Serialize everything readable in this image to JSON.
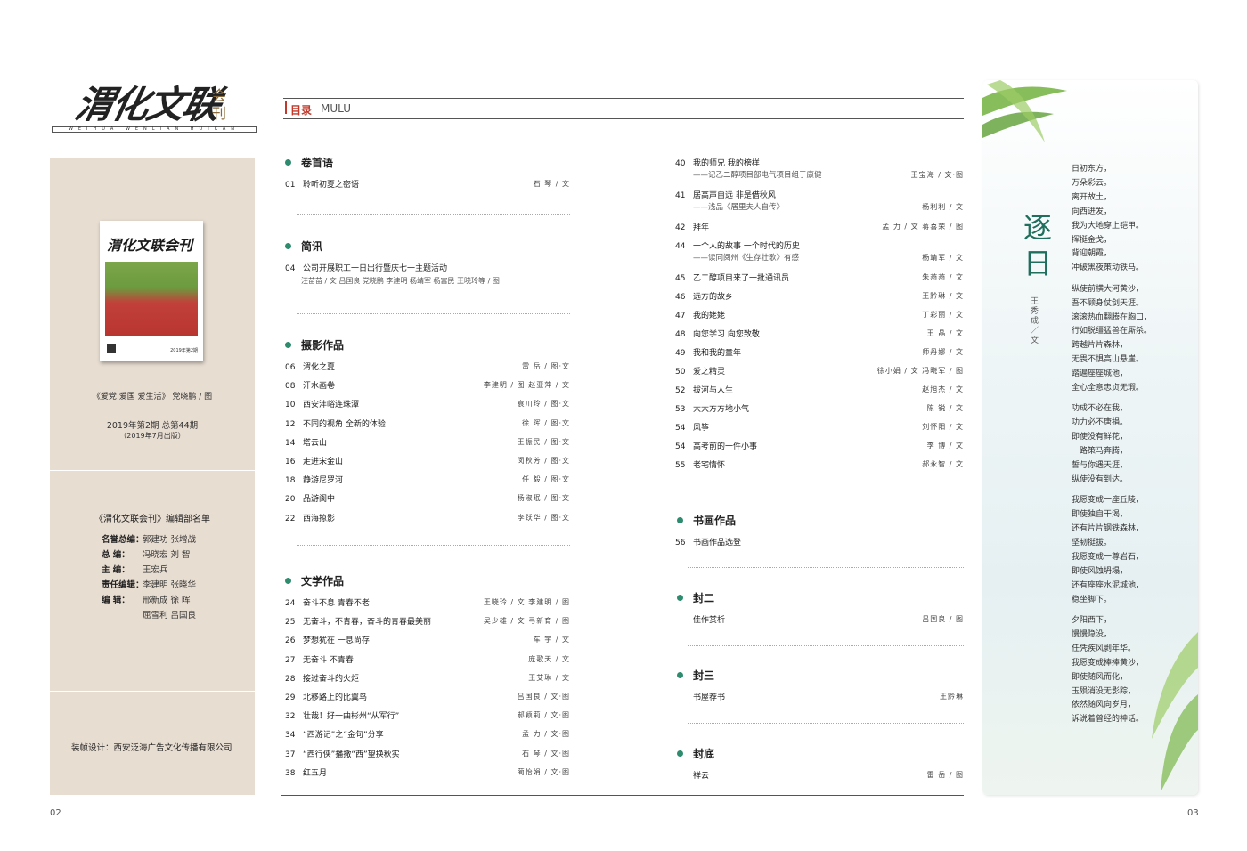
{
  "logo": {
    "main": "渭化文联",
    "sub": "会刊",
    "latin": "WEIHUA WENLIAN HUIKAN"
  },
  "sidebar": {
    "cover_title": "渭化文联会刊",
    "cover_issue": "2019年第2期",
    "cover_caption": "《爱党 爱国 爱生活》 党晓鹏 / 图",
    "issue": "2019年第2期 总第44期",
    "issue_date": "（2019年7月出版）",
    "editorial_title": "《渭化文联会刊》编辑部名单",
    "editors": [
      {
        "role": "名誉总编：",
        "names": "郭建功  张增战"
      },
      {
        "role": "总    编：",
        "names": "冯晓宏  刘  智"
      },
      {
        "role": "主    编：",
        "names": "王宏兵"
      },
      {
        "role": "责任编辑：",
        "names": "李建明  张晓华"
      },
      {
        "role": "编    辑：",
        "names": "邢新成  徐  晖"
      },
      {
        "role": "",
        "names": "屈雪利  吕国良"
      }
    ],
    "design": "装帧设计：西安泛海广告文化传播有限公司"
  },
  "page_numbers": {
    "left": "02",
    "right": "03"
  },
  "toc_header": {
    "label": "目录",
    "latin": "MULU"
  },
  "toc_left": [
    {
      "section": "卷首语",
      "entries": [
        {
          "num": "01",
          "title": "聆听初夏之密语",
          "credit": "石  琴 / 文"
        }
      ]
    },
    {
      "section": "简讯",
      "entries": [
        {
          "num": "04",
          "title": "公司开展职工一日出行暨庆七一主题活动",
          "credit": ""
        }
      ],
      "subcredit": "汪苗苗 / 文  吕国良  党晓鹏  李建明  杨靖军  杨富民  王晓玲等 / 图"
    },
    {
      "section": "摄影作品",
      "entries": [
        {
          "num": "06",
          "title": "渭化之夏",
          "credit": "雷  岳 / 图·文"
        },
        {
          "num": "08",
          "title": "汗水画卷",
          "credit": "李建明 / 图  赵亚萍 / 文"
        },
        {
          "num": "10",
          "title": "西安沣峪连珠潭",
          "credit": "袁川玲 / 图·文"
        },
        {
          "num": "12",
          "title": "不同的视角  全新的体验",
          "credit": "徐  晖 / 图·文"
        },
        {
          "num": "14",
          "title": "塔云山",
          "credit": "王振民 / 图·文"
        },
        {
          "num": "16",
          "title": "走进宋金山",
          "credit": "闵秋芳 / 图·文"
        },
        {
          "num": "18",
          "title": "静游尼罗河",
          "credit": "任  毅 / 图·文"
        },
        {
          "num": "20",
          "title": "品游阆中",
          "credit": "杨淑珉 / 图·文"
        },
        {
          "num": "22",
          "title": "西海掠影",
          "credit": "李跃华 / 图·文"
        }
      ]
    },
    {
      "section": "文学作品",
      "entries": [
        {
          "num": "24",
          "title": "奋斗不息  青春不老",
          "credit": "王晓玲 / 文  李建明 / 图"
        },
        {
          "num": "25",
          "title": "无奋斗，不青春，奋斗的青春最美丽",
          "credit": "吴少雄 / 文  弓新育 / 图"
        },
        {
          "num": "26",
          "title": "梦想犹在  一息尚存",
          "credit": "车  宇 / 文"
        },
        {
          "num": "27",
          "title": "无奋斗  不青春",
          "credit": "庞歌天 / 文"
        },
        {
          "num": "28",
          "title": "接过奋斗的火炬",
          "credit": "王艾琳 / 文"
        },
        {
          "num": "29",
          "title": "北移路上的比翼鸟",
          "credit": "吕国良 / 文·图"
        },
        {
          "num": "32",
          "title": "壮哉！好一曲彬州“从军行”",
          "credit": "郝颖莉 / 文·图"
        },
        {
          "num": "34",
          "title": "“西游记”之“金句”分享",
          "credit": "孟  力 / 文·图"
        },
        {
          "num": "37",
          "title": "“西行侠”播撒“西”望换秋实",
          "credit": "石  琴 / 文·图"
        },
        {
          "num": "38",
          "title": "红五月",
          "credit": "蔺怡娟 / 文·图"
        }
      ]
    }
  ],
  "toc_right": {
    "entries": [
      {
        "num": "40",
        "title": "我的师兄  我的榜样",
        "sub": "——记乙二醇项目部电气项目组于康健",
        "credit": "王宝海 / 文·图"
      },
      {
        "num": "41",
        "title": "居高声自远  非是借秋风",
        "sub": "——浅品《居里夫人自传》",
        "credit": "杨利利 / 文"
      },
      {
        "num": "42",
        "title": "拜年",
        "sub": "",
        "credit": "孟  力 / 文  蒋喜荣 / 图"
      },
      {
        "num": "44",
        "title": "一个人的故事  一个时代的历史",
        "sub": "——读同阅州《生存壮歌》有感",
        "credit": "杨靖军 / 文"
      },
      {
        "num": "45",
        "title": "乙二醇项目来了一批通讯员",
        "sub": "",
        "credit": "朱燕燕 / 文"
      },
      {
        "num": "46",
        "title": "远方的故乡",
        "sub": "",
        "credit": "王黔琳 / 文"
      },
      {
        "num": "47",
        "title": "我的姥姥",
        "sub": "",
        "credit": "丁彩丽 / 文"
      },
      {
        "num": "48",
        "title": "向您学习  向您致敬",
        "sub": "",
        "credit": "王  晶 / 文"
      },
      {
        "num": "49",
        "title": "我和我的童年",
        "sub": "",
        "credit": "师丹娜 / 文"
      },
      {
        "num": "50",
        "title": "爱之精灵",
        "sub": "",
        "credit": "徐小娟 / 文  冯晓军 / 图"
      },
      {
        "num": "52",
        "title": "拔河与人生",
        "sub": "",
        "credit": "赵旭杰 / 文"
      },
      {
        "num": "53",
        "title": "大大方方地小气",
        "sub": "",
        "credit": "陈  锐 / 文"
      },
      {
        "num": "54",
        "title": "风筝",
        "sub": "",
        "credit": "刘怀阳 / 文"
      },
      {
        "num": "54",
        "title": "高考前的一件小事",
        "sub": "",
        "credit": "李  博 / 文"
      },
      {
        "num": "55",
        "title": "老宅情怀",
        "sub": "",
        "credit": "郝永智 / 文"
      }
    ],
    "sections": [
      {
        "section": "书画作品",
        "num": "56",
        "title": "书画作品选登",
        "credit": ""
      },
      {
        "section": "封二",
        "num": "",
        "title": "佳作赏析",
        "credit": "吕国良 / 图"
      },
      {
        "section": "封三",
        "num": "",
        "title": "书屋荐书",
        "credit": "王黔琳"
      },
      {
        "section": "封底",
        "num": "",
        "title": "祥云",
        "credit": "雷  岳 / 图"
      }
    ]
  },
  "poem": {
    "title": "逐日",
    "author": "王秀成／文",
    "lines": [
      "日初东方，",
      "万朵彩云。",
      "离开故土，",
      "向西进发，",
      "我为大地穿上铠甲。",
      "挥挺金戈，",
      "背迎朝霞，",
      "冲破黑夜策动铁马。",
      "",
      "纵使前横大河黄沙，",
      "吾不顾身仗剑天涯。",
      "滚滚热血翻腾在胸口，",
      "行如脱缰猛兽在厮杀。",
      "跨越片片森林，",
      "无畏不惧高山悬崖。",
      "踏遍座座城池，",
      "全心全意忠贞无瑕。",
      "",
      "功成不必在我，",
      "功力必不唐捐。",
      "即使没有鲜花，",
      "一路策马奔腾，",
      "誓与你遇天涯，",
      "纵使没有到达。",
      "",
      "我愿变成一座丘陵，",
      "即使独自干渴，",
      "还有片片钢铁森林，",
      "坚韧挺拔。",
      "我愿变成一尊岩石，",
      "即使风蚀坍塌，",
      "还有座座水泥城池，",
      "稳坐脚下。",
      "",
      "夕阳西下，",
      "慢慢隐没，",
      "任凭疾风剥年华。",
      "我愿变成捧捧黄沙，",
      "即使随风而化，",
      "玉殒消没无影踪，",
      "依然随风向岁月，",
      "诉说着曾经的神话。"
    ]
  }
}
